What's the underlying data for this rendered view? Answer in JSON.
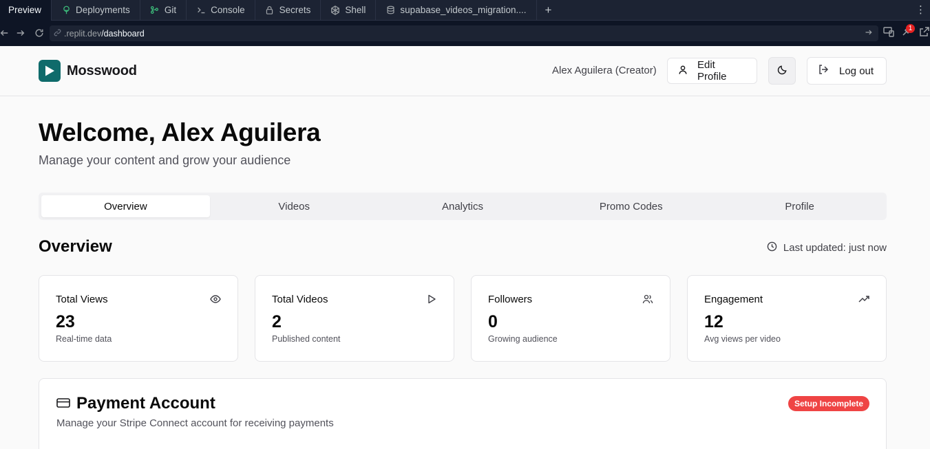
{
  "ide_tabs": [
    {
      "label": "Preview",
      "icon": "preview-icon"
    },
    {
      "label": "Deployments",
      "icon": "deployments-icon"
    },
    {
      "label": "Git",
      "icon": "git-icon"
    },
    {
      "label": "Console",
      "icon": "terminal-icon"
    },
    {
      "label": "Secrets",
      "icon": "lock-icon"
    },
    {
      "label": "Shell",
      "icon": "shell-icon"
    },
    {
      "label": "supabase_videos_migration....",
      "icon": "database-icon"
    }
  ],
  "urlbar": {
    "host": ".replit.dev",
    "path": "/dashboard",
    "notification_count": "1"
  },
  "header": {
    "brand": "Mosswood",
    "user": "Alex Aguilera (Creator)",
    "edit_profile": "Edit Profile",
    "logout": "Log out"
  },
  "main": {
    "welcome": "Welcome, Alex Aguilera",
    "subtitle": "Manage your content and grow your audience",
    "tabs": [
      "Overview",
      "Videos",
      "Analytics",
      "Promo Codes",
      "Profile"
    ],
    "active_tab": "Overview",
    "section_title": "Overview",
    "last_updated": "Last updated: just now",
    "stats": [
      {
        "label": "Total Views",
        "value": "23",
        "sub": "Real-time data",
        "icon": "eye-icon"
      },
      {
        "label": "Total Videos",
        "value": "2",
        "sub": "Published content",
        "icon": "play-icon"
      },
      {
        "label": "Followers",
        "value": "0",
        "sub": "Growing audience",
        "icon": "users-icon"
      },
      {
        "label": "Engagement",
        "value": "12",
        "sub": "Avg views per video",
        "icon": "trending-up-icon"
      }
    ],
    "payment": {
      "title": "Payment Account",
      "subtitle": "Manage your Stripe Connect account for receiving payments",
      "status": "Setup Incomplete"
    }
  },
  "colors": {
    "brand": "#0f6b6b",
    "danger": "#ef4444",
    "ide_bg": "#1c2333"
  }
}
